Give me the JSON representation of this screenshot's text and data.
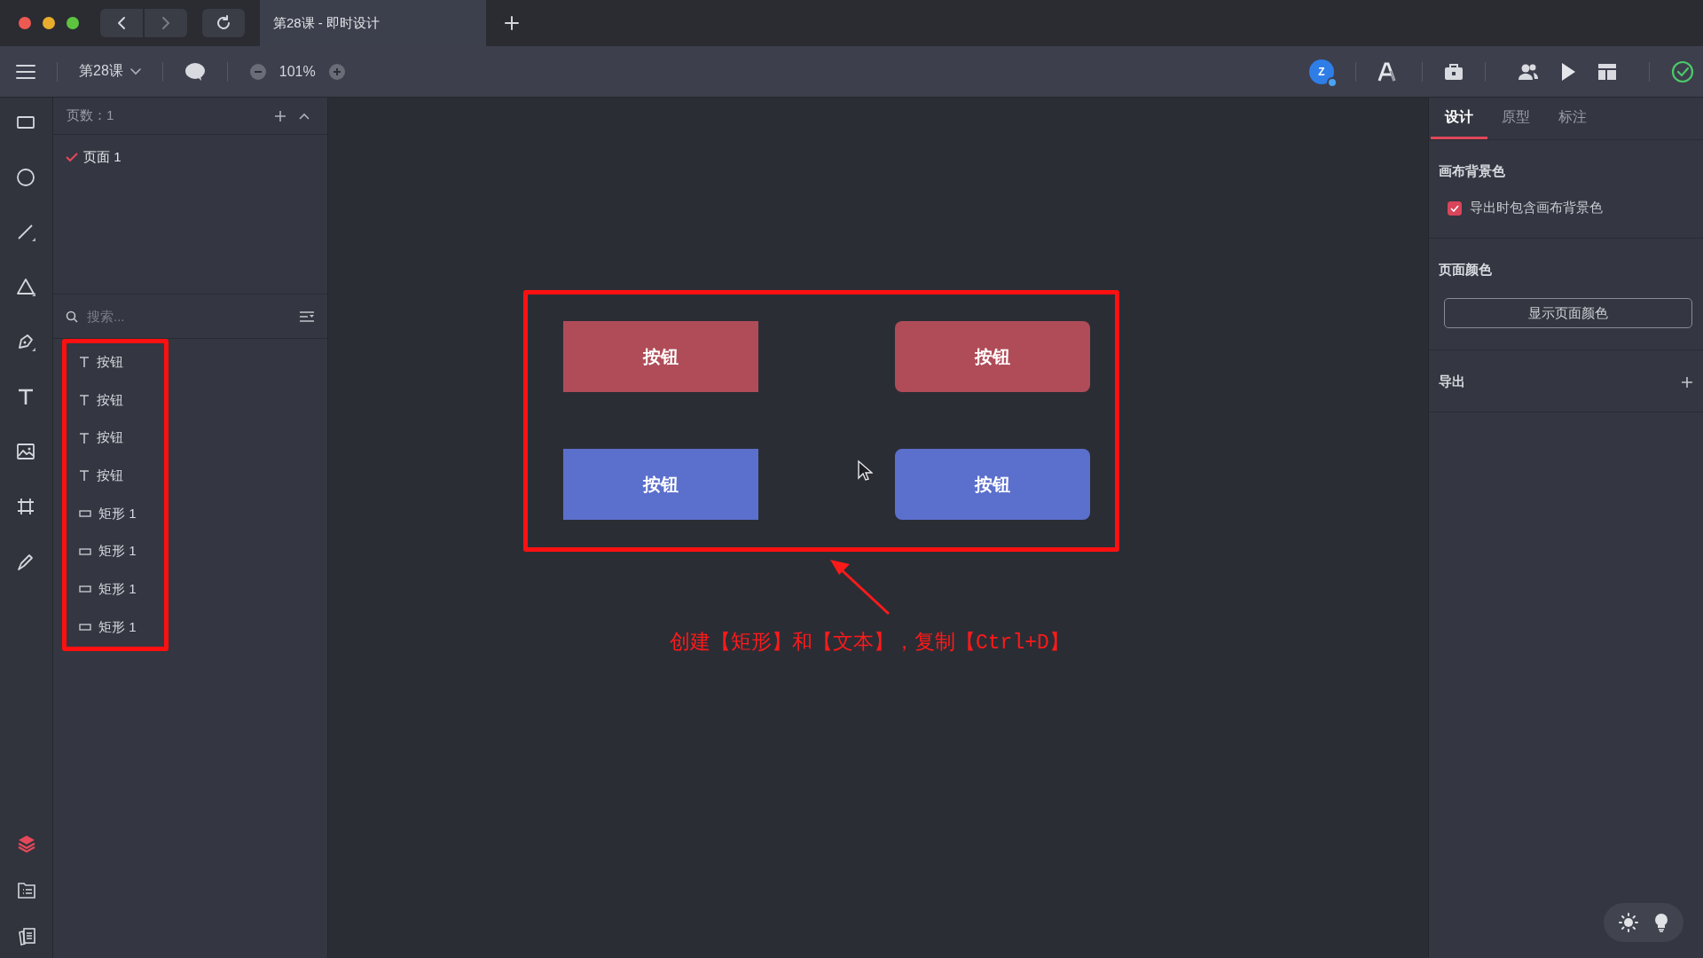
{
  "window": {
    "tab_title": "第28课 - 即时设计"
  },
  "toolbar": {
    "file_name": "第28课",
    "zoom": "101%",
    "avatar_letter": "Z"
  },
  "bottom_nav": [
    {
      "kind": "layers",
      "selected": true
    },
    {
      "kind": "assets",
      "selected": false
    },
    {
      "kind": "pages",
      "selected": false
    }
  ],
  "pages_panel": {
    "count_label": "页数：1",
    "pages": [
      {
        "label": "页面 1",
        "selected": true
      }
    ]
  },
  "layers_panel": {
    "search": {
      "placeholder": "搜索..."
    },
    "layers": [
      {
        "kind": "text",
        "label": "按钮"
      },
      {
        "kind": "text",
        "label": "按钮"
      },
      {
        "kind": "text",
        "label": "按钮"
      },
      {
        "kind": "text",
        "label": "按钮"
      },
      {
        "kind": "rect",
        "label": "矩形 1"
      },
      {
        "kind": "rect",
        "label": "矩形 1"
      },
      {
        "kind": "rect",
        "label": "矩形 1"
      },
      {
        "kind": "rect",
        "label": "矩形 1"
      }
    ]
  },
  "canvas": {
    "elements": [
      {
        "label": "按钮",
        "color": "#b04c58",
        "rounded": false
      },
      {
        "label": "按钮",
        "color": "#b04c58",
        "rounded": true
      },
      {
        "label": "按钮",
        "color": "#5b6fcc",
        "rounded": false
      },
      {
        "label": "按钮",
        "color": "#5b6fcc",
        "rounded": true
      }
    ],
    "caption": "创建【矩形】和【文本】，复制【Ctrl+D】"
  },
  "inspector": {
    "tabs": [
      {
        "label": "设计",
        "selected": true
      },
      {
        "label": "原型",
        "selected": false
      },
      {
        "label": "标注",
        "selected": false
      }
    ],
    "canvas_bg": {
      "heading": "画布背景色",
      "checkbox": {
        "label": "导出时包含画布背景色",
        "checked": true
      }
    },
    "page_color": {
      "heading": "页面颜色",
      "button": "显示页面颜色"
    },
    "export": {
      "heading": "导出"
    }
  }
}
